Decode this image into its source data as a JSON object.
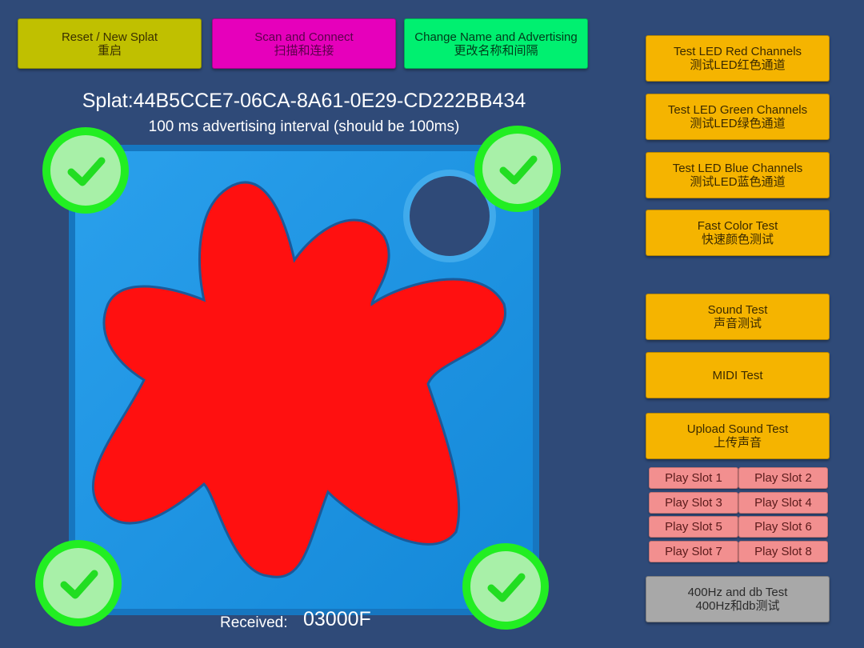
{
  "top_buttons": {
    "reset": {
      "en": "Reset / New Splat",
      "zh": "重启"
    },
    "scan": {
      "en": "Scan and Connect",
      "zh": "扫描和连接"
    },
    "rename": {
      "en": "Change Name and Advertising",
      "zh": "更改名称和间隔"
    }
  },
  "device": {
    "id_text": "Splat:44B5CCE7-06CA-8A61-0E29-CD222BB434",
    "interval_text": "100  ms advertising interval (should be 100ms)"
  },
  "status": {
    "received_label": "Received:",
    "received_value": "03000F"
  },
  "side_buttons": {
    "led_red": {
      "en": "Test LED Red Channels",
      "zh": "测试LED红色通道"
    },
    "led_green": {
      "en": "Test LED Green Channels",
      "zh": "测试LED绿色通道"
    },
    "led_blue": {
      "en": "Test LED Blue Channels",
      "zh": "测试LED蓝色通道"
    },
    "fast_color": {
      "en": "Fast Color Test",
      "zh": "快速颜色测试"
    },
    "sound": {
      "en": "Sound Test",
      "zh": "声音测试"
    },
    "midi": {
      "en": "MIDI Test"
    },
    "upload_sound": {
      "en": "Upload Sound Test",
      "zh": "上传声音"
    },
    "hz_db": {
      "en": "400Hz and db Test",
      "zh": "400Hz和db测试"
    }
  },
  "slots": [
    "Play Slot 1",
    "Play Slot 2",
    "Play Slot 3",
    "Play Slot 4",
    "Play Slot 5",
    "Play Slot 6",
    "Play Slot 7",
    "Play Slot 8"
  ],
  "colors": {
    "background": "#2f4a78",
    "pad_blue": "#1a8fe0",
    "splat_red": "#ff1010",
    "check_green": "#22ee22",
    "button_orange": "#f5b400",
    "slot_pink": "#f28f8f"
  },
  "icons": {
    "corner_indicator": "check-icon"
  }
}
